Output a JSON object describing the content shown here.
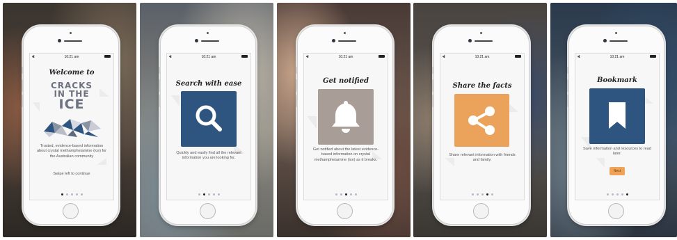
{
  "status_bar": {
    "time": "10:21 am",
    "signal": "•ıl"
  },
  "colors": {
    "search": "#2d5580",
    "notify": "#a99d98",
    "share": "#eba35c",
    "bookmark": "#2d5580",
    "next_button": "#efa359"
  },
  "screens": [
    {
      "title": "Welcome to",
      "logo": {
        "line1": "CRACKS",
        "line2": "IN THE",
        "line3": "ICE"
      },
      "description": "Trusted, evidence-based information about crystal methamphetamine (ice) for the Australian community",
      "hint": "Swipe left to continue",
      "active_dot": 0
    },
    {
      "title": "Search with ease",
      "icon": "search-icon",
      "description": "Quickly and easily find all the relevant information you are looking for.",
      "active_dot": 1
    },
    {
      "title": "Get notified",
      "icon": "bell-icon",
      "description": "Get notified about the latest evidence-based information on crystal methamphetamine (ice) as it breaks.",
      "active_dot": 2
    },
    {
      "title": "Share the facts",
      "icon": "share-icon",
      "description": "Share relevant information with friends and family.",
      "active_dot": 3
    },
    {
      "title": "Bookmark",
      "icon": "bookmark-icon",
      "description": "Save information and resources to read later.",
      "button": "Next",
      "active_dot": 4
    }
  ]
}
